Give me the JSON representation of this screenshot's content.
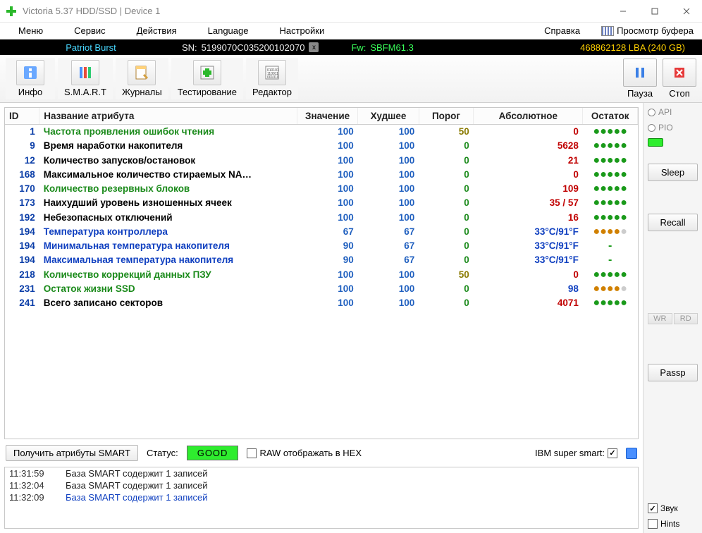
{
  "window": {
    "title": "Victoria 5.37 HDD/SSD | Device 1"
  },
  "menu": {
    "items": [
      "Меню",
      "Сервис",
      "Действия",
      "Language",
      "Настройки"
    ],
    "help": "Справка",
    "viewbuf": "Просмотр буфера"
  },
  "device": {
    "model": "Patriot Burst",
    "sn_label": "SN:",
    "sn": "5199070C035200102070",
    "fw_label": "Fw:",
    "fw": "SBFM61.3",
    "lba": "468862128 LBA (240 GB)"
  },
  "toolbar": {
    "info": "Инфо",
    "smart": "S.M.A.R.T",
    "journals": "Журналы",
    "testing": "Тестирование",
    "editor": "Редактор",
    "pause": "Пауза",
    "stop": "Стоп"
  },
  "smart": {
    "headers": {
      "id": "ID",
      "name": "Название атрибута",
      "value": "Значение",
      "worst": "Худшее",
      "thresh": "Порог",
      "abs": "Абсолютное",
      "rest": "Остаток"
    },
    "rows": [
      {
        "id": "1",
        "name": "Частота проявления ошибок чтения",
        "nameClass": "name-green",
        "val": "100",
        "worst": "100",
        "thresh": "50",
        "threshClass": "thresh-olive",
        "abs": "0",
        "absClass": "abs-red",
        "rest": "dots-green"
      },
      {
        "id": "9",
        "name": "Время наработки накопителя",
        "nameClass": "name-black",
        "val": "100",
        "worst": "100",
        "thresh": "0",
        "threshClass": "thresh-green",
        "abs": "5628",
        "absClass": "abs-red",
        "rest": "dots-green"
      },
      {
        "id": "12",
        "name": "Количество запусков/остановок",
        "nameClass": "name-black",
        "val": "100",
        "worst": "100",
        "thresh": "0",
        "threshClass": "thresh-green",
        "abs": "21",
        "absClass": "abs-red",
        "rest": "dots-green"
      },
      {
        "id": "168",
        "name": "Максимальное количество стираемых NA…",
        "nameClass": "name-black",
        "val": "100",
        "worst": "100",
        "thresh": "0",
        "threshClass": "thresh-green",
        "abs": "0",
        "absClass": "abs-red",
        "rest": "dots-green"
      },
      {
        "id": "170",
        "name": "Количество резервных блоков",
        "nameClass": "name-green",
        "val": "100",
        "worst": "100",
        "thresh": "0",
        "threshClass": "thresh-green",
        "abs": "109",
        "absClass": "abs-red",
        "rest": "dots-green"
      },
      {
        "id": "173",
        "name": "Наихудший уровень изношенных ячеек",
        "nameClass": "name-black",
        "val": "100",
        "worst": "100",
        "thresh": "0",
        "threshClass": "thresh-green",
        "abs": "35 / 57",
        "absClass": "abs-red",
        "rest": "dots-green"
      },
      {
        "id": "192",
        "name": "Небезопасных отключений",
        "nameClass": "name-black",
        "val": "100",
        "worst": "100",
        "thresh": "0",
        "threshClass": "thresh-green",
        "abs": "16",
        "absClass": "abs-red",
        "rest": "dots-green"
      },
      {
        "id": "194",
        "name": "Температура контроллера",
        "nameClass": "name-blue",
        "val": "67",
        "worst": "67",
        "thresh": "0",
        "threshClass": "thresh-green",
        "abs": "33°C/91°F",
        "absClass": "abs-blue",
        "rest": "dots-orange"
      },
      {
        "id": "194",
        "name": "Минимальная температура накопителя",
        "nameClass": "name-blue",
        "val": "90",
        "worst": "67",
        "thresh": "0",
        "threshClass": "thresh-green",
        "abs": "33°C/91°F",
        "absClass": "abs-blue",
        "rest": "dash"
      },
      {
        "id": "194",
        "name": "Максимальная температура накопителя",
        "nameClass": "name-blue",
        "val": "90",
        "worst": "67",
        "thresh": "0",
        "threshClass": "thresh-green",
        "abs": "33°C/91°F",
        "absClass": "abs-blue",
        "rest": "dash"
      },
      {
        "id": "218",
        "name": "Количество коррекций данных ПЗУ",
        "nameClass": "name-green",
        "val": "100",
        "worst": "100",
        "thresh": "50",
        "threshClass": "thresh-olive",
        "abs": "0",
        "absClass": "abs-red",
        "rest": "dots-green"
      },
      {
        "id": "231",
        "name": "Остаток жизни SSD",
        "nameClass": "name-green",
        "val": "100",
        "worst": "100",
        "thresh": "0",
        "threshClass": "thresh-green",
        "abs": "98",
        "absClass": "abs-blue",
        "rest": "dots-orange"
      },
      {
        "id": "241",
        "name": "Всего записано секторов",
        "nameClass": "name-black",
        "val": "100",
        "worst": "100",
        "thresh": "0",
        "threshClass": "thresh-green",
        "abs": "4071",
        "absClass": "abs-red",
        "rest": "dots-green"
      }
    ]
  },
  "bottom": {
    "get_smart": "Получить атрибуты SMART",
    "status_label": "Статус:",
    "status_value": "GOOD",
    "raw_hex": "RAW отображать в HEX",
    "ibm_label": "IBM super smart:"
  },
  "log": [
    {
      "ts": "11:31:59",
      "msg": "База SMART содержит 1 записей",
      "cls": "msg-black"
    },
    {
      "ts": "11:32:04",
      "msg": "База SMART содержит 1 записей",
      "cls": "msg-black"
    },
    {
      "ts": "11:32:09",
      "msg": "База SMART содержит 1 записей",
      "cls": "msg-blue"
    }
  ],
  "side": {
    "api": "API",
    "pio": "PIO",
    "sleep": "Sleep",
    "recall": "Recall",
    "wr": "WR",
    "rd": "RD",
    "passp": "Passp",
    "sound": "Звук",
    "hints": "Hints"
  }
}
